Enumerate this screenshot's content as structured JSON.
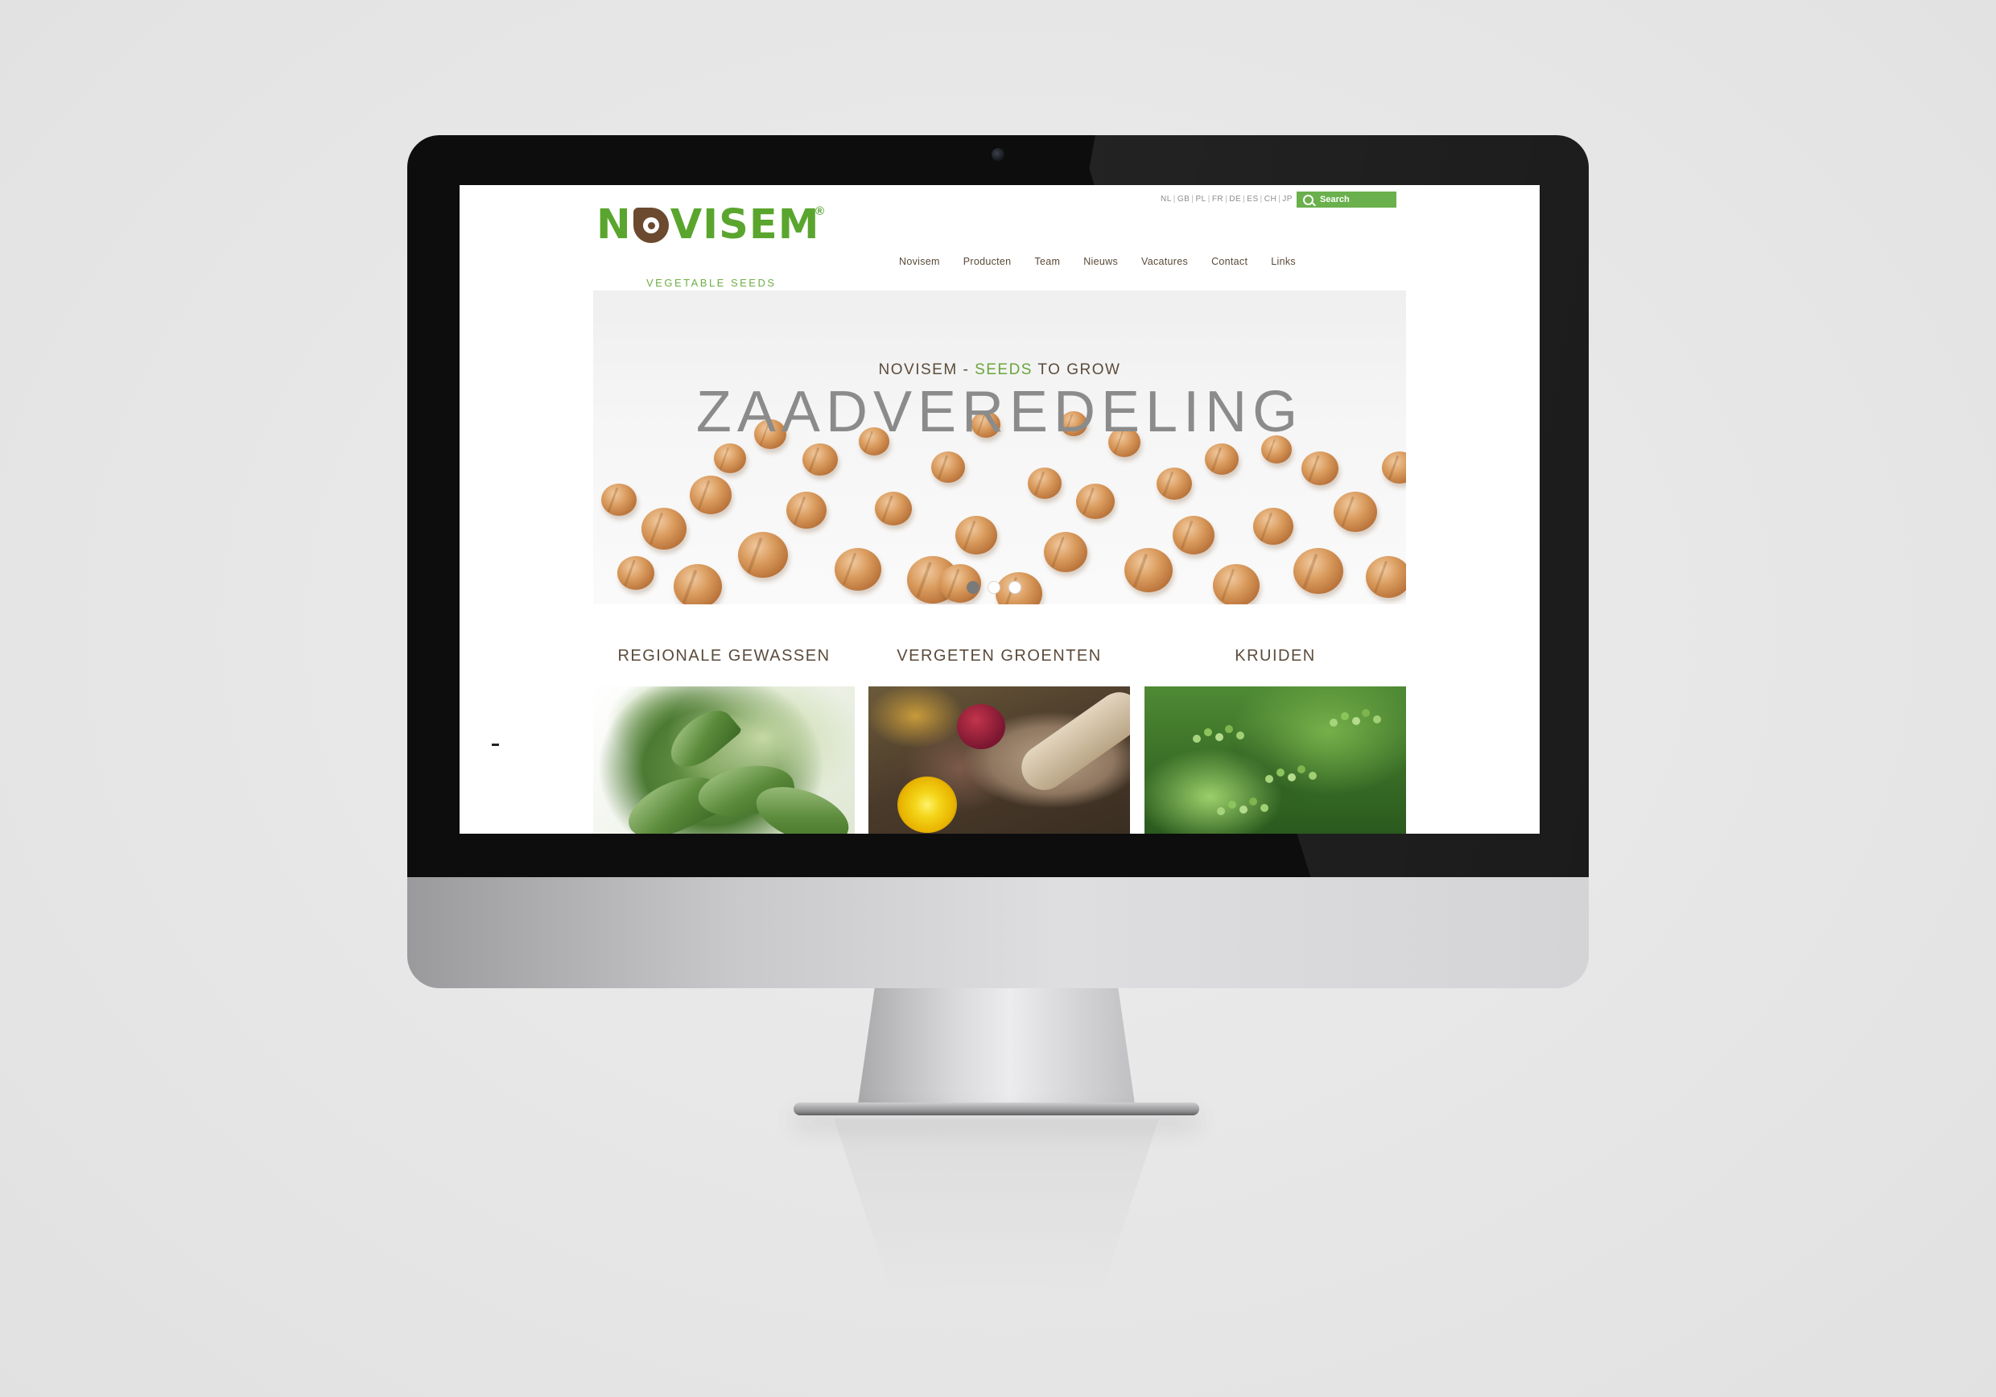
{
  "site": {
    "logo_word_left": "N",
    "logo_word_right": "VISEM",
    "logo_registered": "®",
    "logo_tagline": "VEGETABLE SEEDS"
  },
  "languages": [
    "NL",
    "GB",
    "PL",
    "FR",
    "DE",
    "ES",
    "CH",
    "JP"
  ],
  "search": {
    "placeholder": "Search"
  },
  "nav": [
    "Novisem",
    "Producten",
    "Team",
    "Nieuws",
    "Vacatures",
    "Contact",
    "Links"
  ],
  "hero": {
    "subtitle_prefix": "NOVISEM - ",
    "subtitle_highlight": "SEEDS",
    "subtitle_suffix": " TO GROW",
    "title": "ZAADVEREDELING",
    "slides": 3,
    "active_slide": 1
  },
  "categories": [
    {
      "title": "REGIONALE GEWASSEN",
      "image": "artichoke"
    },
    {
      "title": "VERGETEN GROENTEN",
      "image": "root-vegetables"
    },
    {
      "title": "KRUIDEN",
      "image": "herbs"
    }
  ],
  "colors": {
    "brand_green": "#5aa52e",
    "brand_brown": "#6b4a2f",
    "search_green": "#6ab04c",
    "text_brown": "#5b4b3b",
    "hero_title_gray": "#8b8b8b"
  }
}
